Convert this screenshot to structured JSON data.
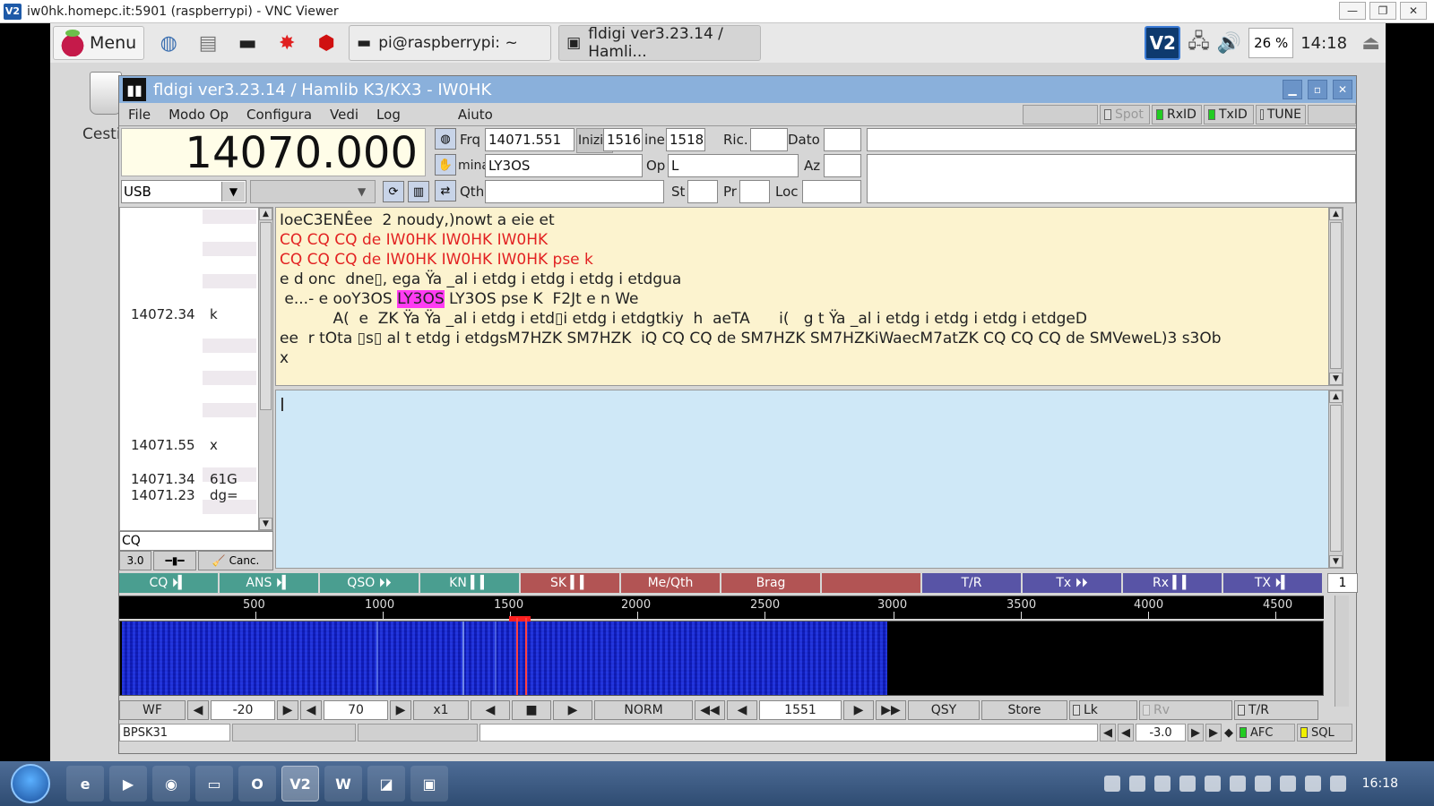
{
  "vnc": {
    "title": "iw0hk.homepc.it:5901 (raspberrypi) - VNC Viewer",
    "logo": "V2"
  },
  "pi_panel": {
    "menu_label": "Menu",
    "terminal_task": "pi@raspberrypi: ~",
    "fldigi_task": "fldigi ver3.23.14 / Hamli...",
    "cpu": "26 %",
    "clock": "14:18"
  },
  "desktop": {
    "trash_label": "Cesti"
  },
  "window": {
    "title": "fldigi ver3.23.14 / Hamlib K3/KX3 - IW0HK"
  },
  "menubar": {
    "items": [
      "File",
      "Modo Op",
      "Configura",
      "Vedi",
      "Log",
      "Aiuto"
    ],
    "spot": "Spot",
    "rxid": "RxID",
    "txid": "TxID",
    "tune": "TUNE"
  },
  "rig": {
    "frequency": "14070.000",
    "mode": "USB",
    "frq_label": "Frq",
    "frq_value": "14071.551",
    "inizio_label": "Inizio",
    "inizio_value": "1516",
    "fine_label": "ine",
    "fine_value": "1518",
    "ric_label": "Ric.",
    "ric_value": "",
    "dato_label": "Dato",
    "dato_value": "",
    "call_label": "minativo",
    "call_value": "LY3OS",
    "op_label": "Op",
    "op_value": "L",
    "az_label": "Az",
    "az_value": "",
    "qth_label": "Qth",
    "qth_value": "",
    "st_label": "St",
    "st_value": "",
    "pr_label": "Pr",
    "pr_value": "",
    "loc_label": "Loc",
    "loc_value": ""
  },
  "browser": {
    "rows": [
      {
        "freq": "14072.34",
        "text": "k"
      },
      {
        "freq": "14071.55",
        "text": "x"
      },
      {
        "freq": "14071.34",
        "text": "61G"
      },
      {
        "freq": "14071.23",
        "text": "dg="
      }
    ],
    "search": "CQ",
    "squelch": "3.0",
    "cancel": "Canc."
  },
  "rx_text": {
    "line1": "IoeC3ENÊee  2 noudy,)nowt a eie et",
    "line2": "CQ CQ CQ de IW0HK IW0HK IW0HK",
    "line3": "CQ CQ CQ de IW0HK IW0HK IW0HK pse k",
    "line4": "e d onc  dne▯, ega Ÿa _al i etdg i etdg i etdg i etdgua",
    "line5a": " e...- e ooY3OS ",
    "line5b": "LY3OS",
    "line5c": " LY3OS pse K  F2Jt e n We",
    "line6": "           A(  e  ZK Ÿa Ÿa _al i etdg i etd▯i etdg i etdgtkiy  h  aeTA      i(   g t Ÿa _al i etdg i etdg i etdg i etdgeD",
    "line7": "ee  r tOta ▯s▯ al t etdg i etdgsM7HZK SM7HZK  iQ CQ CQ de SM7HZK SM7HZKiWaecM7atZK CQ CQ CQ de SMVeweL)3 s3Ob",
    "line8": "x"
  },
  "macros": [
    {
      "label": "CQ ⏵▍",
      "color": "g"
    },
    {
      "label": "ANS ⏵▍",
      "color": "g"
    },
    {
      "label": "QSO ⏵⏵",
      "color": "g"
    },
    {
      "label": "KN ▍▍",
      "color": "g"
    },
    {
      "label": "SK ▍▍",
      "color": "r"
    },
    {
      "label": "Me/Qth",
      "color": "r"
    },
    {
      "label": "Brag",
      "color": "r"
    },
    {
      "label": "",
      "color": "r"
    },
    {
      "label": "T/R",
      "color": "p"
    },
    {
      "label": "Tx ⏵⏵",
      "color": "p"
    },
    {
      "label": "Rx ▍▍",
      "color": "p"
    },
    {
      "label": "TX ⏵▍",
      "color": "p"
    }
  ],
  "macro_set": "1",
  "ruler": {
    "ticks": [
      "500",
      "1000",
      "1500",
      "2000",
      "2500",
      "3000",
      "3500",
      "4000",
      "4500"
    ]
  },
  "waterfall_controls": {
    "wf": "WF",
    "ref": "-20",
    "range": "70",
    "zoom": "x1",
    "norm": "NORM",
    "freq": "1551",
    "qsy": "QSY",
    "store": "Store",
    "lk": "Lk",
    "rv": "Rv",
    "tr": "T/R"
  },
  "status": {
    "mode": "BPSK31",
    "offset": "-3.0",
    "afc": "AFC",
    "sql": "SQL"
  },
  "taskbar": {
    "clock": "16:18"
  },
  "colors": {
    "rx_bg": "#fcf3cf",
    "tx_bg": "#cfe8f7",
    "title_bar": "#8ab0db",
    "highlight": "#ff3cf3"
  }
}
